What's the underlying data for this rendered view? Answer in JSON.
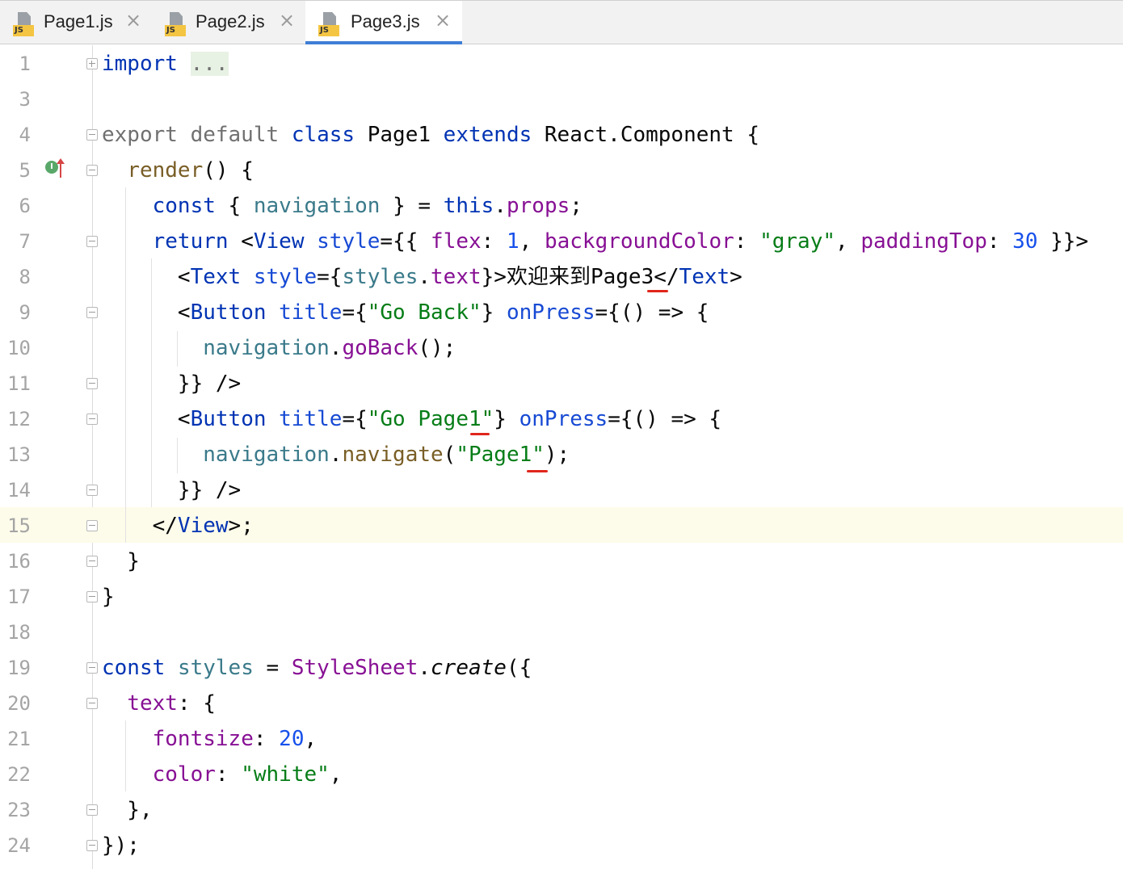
{
  "tabs": [
    {
      "label": "Page1.js",
      "icon": "js-file-icon",
      "active": false
    },
    {
      "label": "Page2.js",
      "icon": "js-file-icon",
      "active": false
    },
    {
      "label": "Page3.js",
      "icon": "js-file-icon",
      "active": true
    }
  ],
  "gutter_icons": {
    "implements": "implements-icon",
    "implements_letter": "I",
    "override": "override-arrow-icon"
  },
  "colors": {
    "accent": "#3f7ed6",
    "current_line": "#fdfbea",
    "error_underline": "#e0261b",
    "keyword": "#0033b3",
    "string": "#067d17"
  },
  "editor": {
    "current_line": "15",
    "lines": [
      {
        "num": "1",
        "text": "import ..."
      },
      {
        "num": "3",
        "text": ""
      },
      {
        "num": "4",
        "text": "export default class Page1 extends React.Component {"
      },
      {
        "num": "5",
        "text": "  render() {"
      },
      {
        "num": "6",
        "text": "    const { navigation } = this.props;"
      },
      {
        "num": "7",
        "text": "    return <View style={{ flex: 1, backgroundColor: \"gray\", paddingTop: 30 }}>"
      },
      {
        "num": "8",
        "text": "      <Text style={styles.text}>欢迎来到Page3</Text>"
      },
      {
        "num": "9",
        "text": "      <Button title={\"Go Back\"} onPress={() => {"
      },
      {
        "num": "10",
        "text": "        navigation.goBack();"
      },
      {
        "num": "11",
        "text": "      }} />"
      },
      {
        "num": "12",
        "text": "      <Button title={\"Go Page1\"} onPress={() => {"
      },
      {
        "num": "13",
        "text": "        navigation.navigate(\"Page1\");"
      },
      {
        "num": "14",
        "text": "      }} />"
      },
      {
        "num": "15",
        "text": "    </View>;"
      },
      {
        "num": "16",
        "text": "  }"
      },
      {
        "num": "17",
        "text": "}"
      },
      {
        "num": "18",
        "text": ""
      },
      {
        "num": "19",
        "text": "const styles = StyleSheet.create({"
      },
      {
        "num": "20",
        "text": "  text: {"
      },
      {
        "num": "21",
        "text": "    fontsize: 20,"
      },
      {
        "num": "22",
        "text": "    color: \"white\","
      },
      {
        "num": "23",
        "text": "  },"
      },
      {
        "num": "24",
        "text": "});"
      }
    ]
  }
}
